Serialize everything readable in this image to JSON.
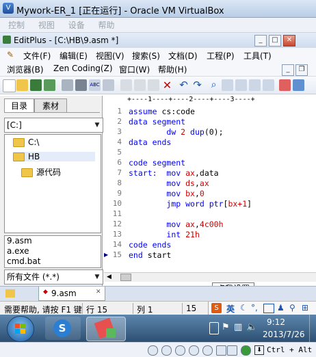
{
  "vm_window": {
    "title": "Mywork-ER_1 [正在运行] - Oracle VM VirtualBox",
    "menu": [
      "控制",
      "视图",
      "设备",
      "帮助"
    ]
  },
  "editplus": {
    "title": "EditPlus - [C:\\HB\\9.asm *]",
    "menu_row1": [
      "文件(F)",
      "编辑(E)",
      "视图(V)",
      "搜索(S)",
      "文档(D)",
      "工程(P)",
      "工具(T)"
    ],
    "menu_row2": [
      "浏览器(B)",
      "Zen Coding(Z)",
      "窗口(W)",
      "帮助(H)"
    ]
  },
  "sidebar": {
    "tabs": [
      "目录",
      "素材"
    ],
    "drive": "[C:]",
    "tree": [
      "C:\\",
      "HB",
      "源代码"
    ],
    "files": [
      "9.asm",
      "a.exe",
      "cmd.bat"
    ],
    "filter": "所有文件 (*.*)"
  },
  "editor": {
    "ruler": "+----1----+----2----+----3----+",
    "lines": [
      {
        "n": "1",
        "tokens": [
          [
            "kw",
            "assume"
          ],
          [
            "",
            "cs:code"
          ]
        ]
      },
      {
        "n": "2",
        "tokens": [
          [
            "kw",
            "data"
          ],
          [
            "kw",
            "segment"
          ]
        ]
      },
      {
        "n": "3",
        "tokens": [
          [
            "",
            "        "
          ],
          [
            "kw",
            "dw"
          ],
          [
            "num",
            "2"
          ],
          [
            "kw",
            "dup"
          ],
          [
            "",
            "(0);"
          ]
        ]
      },
      {
        "n": "4",
        "tokens": [
          [
            "kw",
            "data"
          ],
          [
            "kw",
            "ends"
          ]
        ]
      },
      {
        "n": "5",
        "tokens": []
      },
      {
        "n": "6",
        "tokens": [
          [
            "kw",
            "code"
          ],
          [
            "kw",
            "segment"
          ]
        ]
      },
      {
        "n": "7",
        "tokens": [
          [
            "kw",
            "start:"
          ],
          [
            "",
            "  "
          ],
          [
            "kw",
            "mov"
          ],
          [
            "num",
            "ax"
          ],
          [
            "",
            ",data"
          ]
        ]
      },
      {
        "n": "8",
        "tokens": [
          [
            "",
            "        "
          ],
          [
            "kw",
            "mov"
          ],
          [
            "num",
            "ds"
          ],
          [
            "",
            ","
          ],
          [
            "num",
            "ax"
          ]
        ]
      },
      {
        "n": "9",
        "tokens": [
          [
            "",
            "        "
          ],
          [
            "kw",
            "mov"
          ],
          [
            "num",
            "bx"
          ],
          [
            "",
            ","
          ],
          [
            "num",
            "0"
          ]
        ]
      },
      {
        "n": "10",
        "tokens": [
          [
            "",
            "        "
          ],
          [
            "kw",
            "jmp"
          ],
          [
            "kw",
            "word"
          ],
          [
            "kw",
            "ptr"
          ],
          [
            "",
            "["
          ],
          [
            "num",
            "bx"
          ],
          [
            "num",
            "+1"
          ],
          [
            "",
            "]"
          ]
        ]
      },
      {
        "n": "11",
        "tokens": []
      },
      {
        "n": "12",
        "tokens": [
          [
            "",
            "        "
          ],
          [
            "kw",
            "mov"
          ],
          [
            "num",
            "ax"
          ],
          [
            "",
            ","
          ],
          [
            "num",
            "4c00h"
          ]
        ]
      },
      {
        "n": "13",
        "tokens": [
          [
            "",
            "        "
          ],
          [
            "kw",
            "int"
          ],
          [
            "num",
            "21h"
          ]
        ]
      },
      {
        "n": "14",
        "tokens": [
          [
            "kw",
            "code"
          ],
          [
            "kw",
            "ends"
          ]
        ]
      },
      {
        "n": "15",
        "tokens": [
          [
            "kw",
            "end"
          ],
          [
            "",
            "start"
          ]
        ]
      }
    ]
  },
  "tooltip": "点我设置",
  "doc_tab": "9.asm",
  "status": {
    "help": "需要帮助, 请按 F1 键",
    "row": "行 15",
    "col": "列 1",
    "num": "15"
  },
  "taskbar": {
    "ime": "英",
    "time": "9:12",
    "date": "2013/7/26"
  },
  "vm_status": {
    "host_key": "Ctrl + Alt"
  },
  "colors": {
    "keyword": "#0000ff",
    "number": "#cc0000",
    "folder": "#f0c64a"
  }
}
